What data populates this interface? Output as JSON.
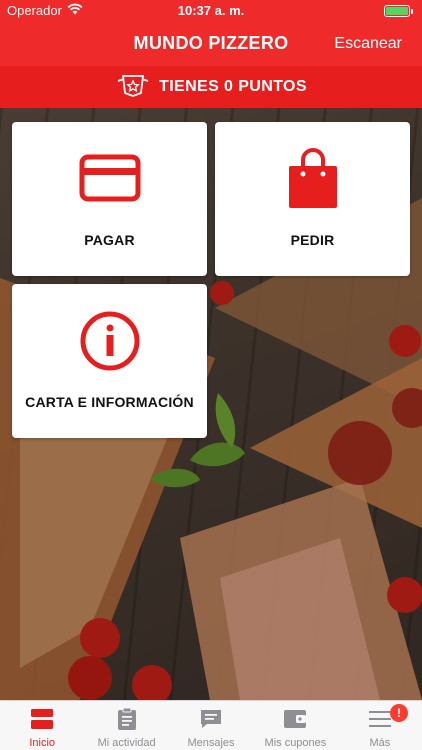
{
  "status_bar": {
    "carrier": "Operador",
    "time": "10:37 a. m."
  },
  "nav": {
    "title": "MUNDO PIZZERO",
    "action_label": "Escanear"
  },
  "points_banner": {
    "text": "TIENES 0 PUNTOS",
    "icon": "badge-star-icon"
  },
  "tiles": [
    {
      "label": "PAGAR",
      "icon": "credit-card-icon"
    },
    {
      "label": "PEDIR",
      "icon": "shopping-bag-icon"
    },
    {
      "label": "CARTA E INFORMACIÓN",
      "icon": "info-icon"
    }
  ],
  "tab_bar": {
    "tabs": [
      {
        "label": "Inicio",
        "icon": "home-card-icon",
        "active": true
      },
      {
        "label": "Mi actividad",
        "icon": "clipboard-icon"
      },
      {
        "label": "Mensajes",
        "icon": "message-icon"
      },
      {
        "label": "Mis cupones",
        "icon": "wallet-icon"
      },
      {
        "label": "Más",
        "icon": "menu-icon",
        "badge": "!"
      }
    ]
  },
  "colors": {
    "primary": "#EE2A2A",
    "banner": "#E61E1E",
    "tab_inactive": "#8E8E93",
    "badge": "#FF3B30"
  }
}
